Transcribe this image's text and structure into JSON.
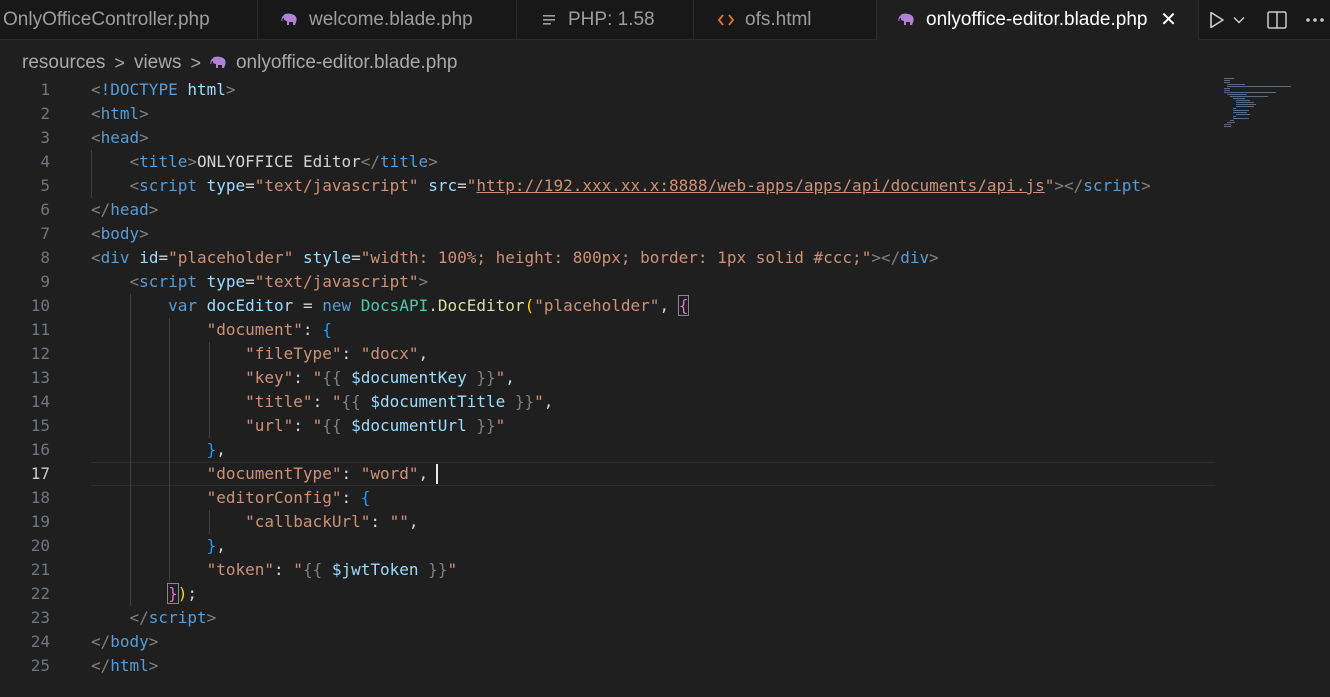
{
  "tabs": [
    {
      "label": "OnlyOfficeController.php",
      "icon": "php-file-icon",
      "active": false
    },
    {
      "label": "welcome.blade.php",
      "icon": "blade-elephant-icon",
      "active": false
    },
    {
      "label": "PHP: 1.58",
      "icon": "lines-list-icon",
      "active": false
    },
    {
      "label": "ofs.html",
      "icon": "html-code-icon",
      "active": false
    },
    {
      "label": "onlyoffice-editor.blade.php",
      "icon": "blade-elephant-icon",
      "active": true,
      "close": "✕"
    }
  ],
  "toolbar": {
    "run_icon": "run-play-icon",
    "run_dropdown_icon": "chevron-down-icon",
    "split_icon": "split-editor-icon",
    "more_icon": "more-actions-icon"
  },
  "breadcrumb": {
    "items": [
      "resources",
      "views",
      "onlyoffice-editor.blade.php"
    ],
    "separator": ">",
    "file_icon": "blade-elephant-icon"
  },
  "editor": {
    "current_line": 17,
    "lines": [
      {
        "n": "1",
        "t": [
          [
            "punct",
            "<"
          ],
          [
            "tag",
            "!DOCTYPE"
          ],
          [
            "plain",
            " "
          ],
          [
            "attr",
            "html"
          ],
          [
            "punct",
            ">"
          ]
        ]
      },
      {
        "n": "2",
        "t": [
          [
            "punct",
            "<"
          ],
          [
            "tag",
            "html"
          ],
          [
            "punct",
            ">"
          ]
        ]
      },
      {
        "n": "3",
        "t": [
          [
            "punct",
            "<"
          ],
          [
            "tag",
            "head"
          ],
          [
            "punct",
            ">"
          ]
        ]
      },
      {
        "n": "4",
        "t": [
          [
            "plain",
            "    "
          ],
          [
            "punct",
            "<"
          ],
          [
            "tag",
            "title"
          ],
          [
            "punct",
            ">"
          ],
          [
            "text",
            "ONLYOFFICE Editor"
          ],
          [
            "punct",
            "</"
          ],
          [
            "tag",
            "title"
          ],
          [
            "punct",
            ">"
          ]
        ]
      },
      {
        "n": "5",
        "t": [
          [
            "plain",
            "    "
          ],
          [
            "punct",
            "<"
          ],
          [
            "tag",
            "script"
          ],
          [
            "plain",
            " "
          ],
          [
            "attr",
            "type"
          ],
          [
            "op",
            "="
          ],
          [
            "str",
            "\"text/javascript\""
          ],
          [
            "plain",
            " "
          ],
          [
            "attr",
            "src"
          ],
          [
            "op",
            "="
          ],
          [
            "str",
            "\""
          ],
          [
            "link",
            "http://192.xxx.xx.x:8888/web-apps/apps/api/documents/api.js"
          ],
          [
            "str",
            "\""
          ],
          [
            "punct",
            "></"
          ],
          [
            "tag",
            "script"
          ],
          [
            "punct",
            ">"
          ]
        ]
      },
      {
        "n": "6",
        "t": [
          [
            "punct",
            "</"
          ],
          [
            "tag",
            "head"
          ],
          [
            "punct",
            ">"
          ]
        ]
      },
      {
        "n": "7",
        "t": [
          [
            "punct",
            "<"
          ],
          [
            "tag",
            "body"
          ],
          [
            "punct",
            ">"
          ]
        ]
      },
      {
        "n": "8",
        "t": [
          [
            "punct",
            "<"
          ],
          [
            "tag",
            "div"
          ],
          [
            "plain",
            " "
          ],
          [
            "attr",
            "id"
          ],
          [
            "op",
            "="
          ],
          [
            "str",
            "\"placeholder\""
          ],
          [
            "plain",
            " "
          ],
          [
            "attr",
            "style"
          ],
          [
            "op",
            "="
          ],
          [
            "str",
            "\"width: 100%; height: 800px; border: 1px solid #ccc;\""
          ],
          [
            "punct",
            "></"
          ],
          [
            "tag",
            "div"
          ],
          [
            "punct",
            ">"
          ]
        ]
      },
      {
        "n": "9",
        "t": [
          [
            "plain",
            "    "
          ],
          [
            "punct",
            "<"
          ],
          [
            "tag",
            "script"
          ],
          [
            "plain",
            " "
          ],
          [
            "attr",
            "type"
          ],
          [
            "op",
            "="
          ],
          [
            "str",
            "\"text/javascript\""
          ],
          [
            "punct",
            ">"
          ]
        ]
      },
      {
        "n": "10",
        "t": [
          [
            "plain",
            "        "
          ],
          [
            "kw",
            "var"
          ],
          [
            "plain",
            " "
          ],
          [
            "var",
            "docEditor"
          ],
          [
            "plain",
            " "
          ],
          [
            "op",
            "="
          ],
          [
            "plain",
            " "
          ],
          [
            "kw",
            "new"
          ],
          [
            "plain",
            " "
          ],
          [
            "cls",
            "DocsAPI"
          ],
          [
            "op",
            "."
          ],
          [
            "fn",
            "DocEditor"
          ],
          [
            "br1",
            "("
          ],
          [
            "str",
            "\"placeholder\""
          ],
          [
            "op",
            ", "
          ],
          [
            "br2m",
            "{"
          ]
        ]
      },
      {
        "n": "11",
        "t": [
          [
            "plain",
            "            "
          ],
          [
            "str",
            "\"document\""
          ],
          [
            "op",
            ": "
          ],
          [
            "br3",
            "{"
          ]
        ]
      },
      {
        "n": "12",
        "t": [
          [
            "plain",
            "                "
          ],
          [
            "str",
            "\"fileType\""
          ],
          [
            "op",
            ": "
          ],
          [
            "str",
            "\"docx\""
          ],
          [
            "op",
            ","
          ]
        ]
      },
      {
        "n": "13",
        "t": [
          [
            "plain",
            "                "
          ],
          [
            "str",
            "\"key\""
          ],
          [
            "op",
            ": "
          ],
          [
            "str",
            "\""
          ],
          [
            "punct",
            "{{ "
          ],
          [
            "php",
            "$documentKey"
          ],
          [
            "punct",
            " }}"
          ],
          [
            "str",
            "\""
          ],
          [
            "op",
            ","
          ]
        ]
      },
      {
        "n": "14",
        "t": [
          [
            "plain",
            "                "
          ],
          [
            "str",
            "\"title\""
          ],
          [
            "op",
            ": "
          ],
          [
            "str",
            "\""
          ],
          [
            "punct",
            "{{ "
          ],
          [
            "php",
            "$documentTitle"
          ],
          [
            "punct",
            " }}"
          ],
          [
            "str",
            "\""
          ],
          [
            "op",
            ","
          ]
        ]
      },
      {
        "n": "15",
        "t": [
          [
            "plain",
            "                "
          ],
          [
            "str",
            "\"url\""
          ],
          [
            "op",
            ": "
          ],
          [
            "str",
            "\""
          ],
          [
            "punct",
            "{{ "
          ],
          [
            "php",
            "$documentUrl"
          ],
          [
            "punct",
            " }}"
          ],
          [
            "str",
            "\""
          ]
        ]
      },
      {
        "n": "16",
        "t": [
          [
            "plain",
            "            "
          ],
          [
            "br3",
            "}"
          ],
          [
            "op",
            ","
          ]
        ]
      },
      {
        "n": "17",
        "t": [
          [
            "plain",
            "            "
          ],
          [
            "str",
            "\"documentType\""
          ],
          [
            "op",
            ": "
          ],
          [
            "str",
            "\"word\""
          ],
          [
            "op",
            ","
          ]
        ]
      },
      {
        "n": "18",
        "t": [
          [
            "plain",
            "            "
          ],
          [
            "str",
            "\"editorConfig\""
          ],
          [
            "op",
            ": "
          ],
          [
            "br3",
            "{"
          ]
        ]
      },
      {
        "n": "19",
        "t": [
          [
            "plain",
            "                "
          ],
          [
            "str",
            "\"callbackUrl\""
          ],
          [
            "op",
            ": "
          ],
          [
            "str",
            "\"\""
          ],
          [
            "op",
            ","
          ]
        ]
      },
      {
        "n": "20",
        "t": [
          [
            "plain",
            "            "
          ],
          [
            "br3",
            "}"
          ],
          [
            "op",
            ","
          ]
        ]
      },
      {
        "n": "21",
        "t": [
          [
            "plain",
            "            "
          ],
          [
            "str",
            "\"token\""
          ],
          [
            "op",
            ": "
          ],
          [
            "str",
            "\""
          ],
          [
            "punct",
            "{{ "
          ],
          [
            "php",
            "$jwtToken"
          ],
          [
            "punct",
            " }}"
          ],
          [
            "str",
            "\""
          ]
        ]
      },
      {
        "n": "22",
        "t": [
          [
            "plain",
            "        "
          ],
          [
            "br2m",
            "}"
          ],
          [
            "br1",
            ")"
          ],
          [
            "op",
            ";"
          ]
        ]
      },
      {
        "n": "23",
        "t": [
          [
            "plain",
            "    "
          ],
          [
            "punct",
            "</"
          ],
          [
            "tag",
            "script"
          ],
          [
            "punct",
            ">"
          ]
        ]
      },
      {
        "n": "24",
        "t": [
          [
            "punct",
            "</"
          ],
          [
            "tag",
            "body"
          ],
          [
            "punct",
            ">"
          ]
        ]
      },
      {
        "n": "25",
        "t": [
          [
            "punct",
            "</"
          ],
          [
            "tag",
            "html"
          ],
          [
            "punct",
            ">"
          ]
        ]
      }
    ]
  },
  "colors": {
    "background": "#1f1f1f",
    "tabbar": "#181818",
    "tag": "#569cd6",
    "attribute": "#9cdcfe",
    "string": "#ce9178",
    "class": "#4ec9b0",
    "function": "#dcdcaa"
  }
}
